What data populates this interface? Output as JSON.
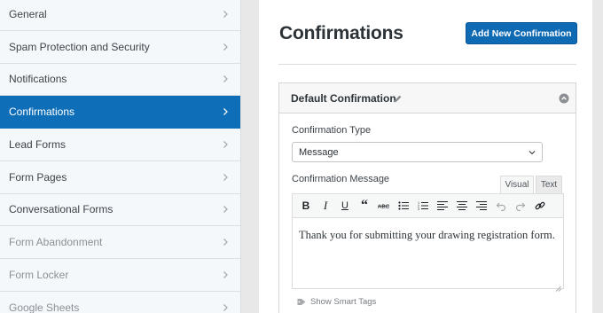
{
  "sidebar": {
    "items": [
      {
        "label": "General",
        "state": "normal"
      },
      {
        "label": "Spam Protection and Security",
        "state": "normal"
      },
      {
        "label": "Notifications",
        "state": "normal"
      },
      {
        "label": "Confirmations",
        "state": "active"
      },
      {
        "label": "Lead Forms",
        "state": "normal"
      },
      {
        "label": "Form Pages",
        "state": "normal"
      },
      {
        "label": "Conversational Forms",
        "state": "normal"
      },
      {
        "label": "Form Abandonment",
        "state": "faded"
      },
      {
        "label": "Form Locker",
        "state": "faded"
      },
      {
        "label": "Google Sheets",
        "state": "faded"
      }
    ]
  },
  "main": {
    "title": "Confirmations",
    "add_button": "Add New Confirmation",
    "confirmation": {
      "title": "Default Confirmation",
      "type_label": "Confirmation Type",
      "type_value": "Message",
      "message_label": "Confirmation Message",
      "tabs": {
        "visual": "Visual",
        "text": "Text"
      },
      "message": "Thank you for submitting your drawing registration form.",
      "smart_tags": "Show Smart Tags"
    }
  },
  "colors": {
    "accent": "#0e6eb8",
    "button": "#0f6ab4"
  },
  "icons": [
    "chevron-right-icon",
    "pencil-icon",
    "collapse-up-icon",
    "chevron-down-icon",
    "tag-icon",
    "bold-icon",
    "italic-icon",
    "underline-icon",
    "blockquote-icon",
    "strikethrough-icon",
    "bullet-list-icon",
    "numbered-list-icon",
    "align-left-icon",
    "align-center-icon",
    "align-right-icon",
    "undo-icon",
    "redo-icon",
    "link-icon"
  ]
}
